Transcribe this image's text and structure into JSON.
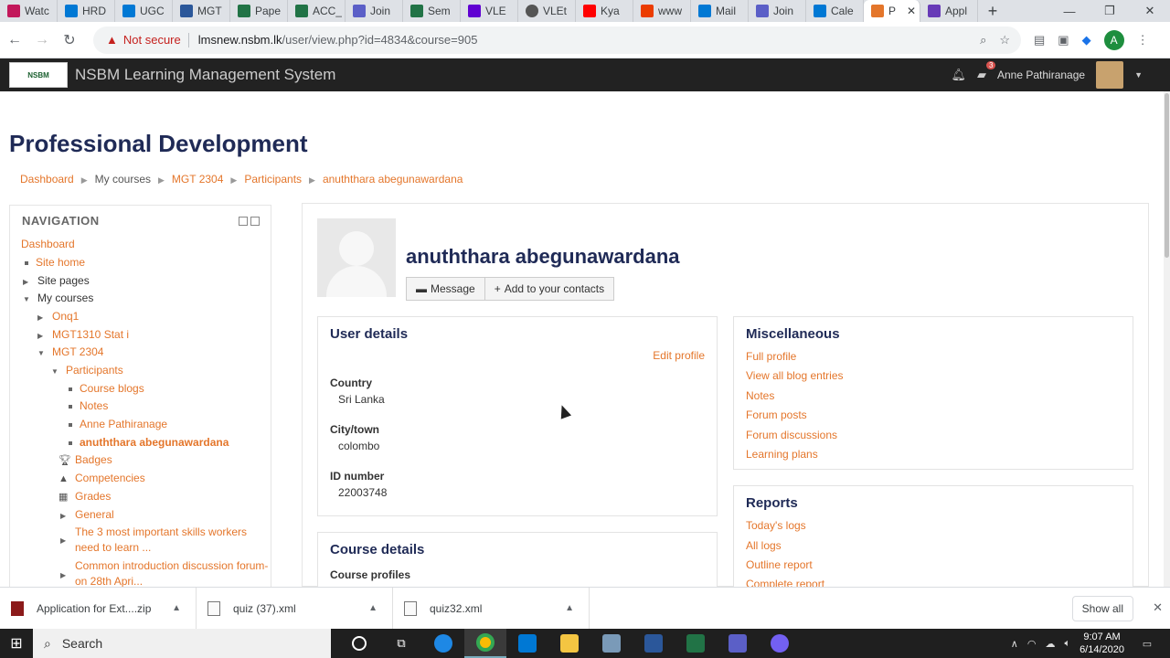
{
  "browser": {
    "tabs": [
      {
        "label": "Watc",
        "color": "#c2185b"
      },
      {
        "label": "HRD",
        "color": "#0078d4"
      },
      {
        "label": "UGC",
        "color": "#0078d4"
      },
      {
        "label": "MGT",
        "color": "#2b579a"
      },
      {
        "label": "Pape",
        "color": "#217346"
      },
      {
        "label": "ACC_",
        "color": "#217346"
      },
      {
        "label": "Join",
        "color": "#5b5fc7"
      },
      {
        "label": "Sem",
        "color": "#217346"
      },
      {
        "label": "VLE",
        "color": "#6001d2"
      },
      {
        "label": "VLEt",
        "color": "#555555"
      },
      {
        "label": "Kya",
        "color": "#ff0000"
      },
      {
        "label": "www",
        "color": "#eb3c00"
      },
      {
        "label": "Mail",
        "color": "#0078d4"
      },
      {
        "label": "Join",
        "color": "#5b5fc7"
      },
      {
        "label": "Cale",
        "color": "#0078d4"
      },
      {
        "label": "P",
        "color": "#e4762b",
        "active": true
      },
      {
        "label": "Appl",
        "color": "#673ab7"
      }
    ],
    "new_tab": "+",
    "not_secure": "Not secure",
    "url_host": "lmsnew.nsbm.lk",
    "url_path": "/user/view.php?id=4834&course=905",
    "profile_initial": "A"
  },
  "moodle": {
    "site_name": "NSBM Learning Management System",
    "logo_text": "NSBM GREEN UNIVERSITY TOWN",
    "message_count": "3",
    "user_name": "Anne Pathiranage"
  },
  "page": {
    "title": "Professional Development",
    "breadcrumbs": [
      "Dashboard",
      "My courses",
      "MGT 2304",
      "Participants",
      "anuththara abegunawardana"
    ]
  },
  "navigation": {
    "heading": "NAVIGATION",
    "items": [
      {
        "label": "Dashboard"
      },
      {
        "label": "Site home"
      },
      {
        "label": "Site pages"
      },
      {
        "label": "My courses"
      },
      {
        "label": "Onq1"
      },
      {
        "label": "MGT1310 Stat i"
      },
      {
        "label": "MGT 2304"
      },
      {
        "label": "Participants"
      },
      {
        "label": "Course blogs"
      },
      {
        "label": "Notes"
      },
      {
        "label": "Anne Pathiranage"
      },
      {
        "label": "anuththara abegunawardana"
      },
      {
        "label": "Badges"
      },
      {
        "label": "Competencies"
      },
      {
        "label": "Grades"
      },
      {
        "label": "General"
      },
      {
        "label": "The 3 most important skills workers"
      },
      {
        "label": "need to learn ..."
      },
      {
        "label": "Common introduction discussion forum-"
      },
      {
        "label": "on 28th Apri..."
      }
    ]
  },
  "profile": {
    "name": "anuththara abegunawardana",
    "message_btn": "Message",
    "add_contact_btn": "Add to your contacts",
    "user_details": {
      "heading": "User details",
      "edit_profile": "Edit profile",
      "country_label": "Country",
      "country": "Sri Lanka",
      "city_label": "City/town",
      "city": "colombo",
      "id_label": "ID number",
      "id": "22003748"
    },
    "misc": {
      "heading": "Miscellaneous",
      "links": [
        "Full profile",
        "View all blog entries",
        "Notes",
        "Forum posts",
        "Forum discussions",
        "Learning plans"
      ]
    },
    "course_details": {
      "heading": "Course details",
      "profiles_label": "Course profiles"
    },
    "reports": {
      "heading": "Reports",
      "links": [
        "Today's logs",
        "All logs",
        "Outline report",
        "Complete report"
      ]
    }
  },
  "downloads": {
    "items": [
      "Application for Ext....zip",
      "quiz (37).xml",
      "quiz32.xml"
    ],
    "show_all": "Show all"
  },
  "taskbar": {
    "search_placeholder": "Search",
    "time": "9:07 AM",
    "date": "6/14/2020"
  }
}
